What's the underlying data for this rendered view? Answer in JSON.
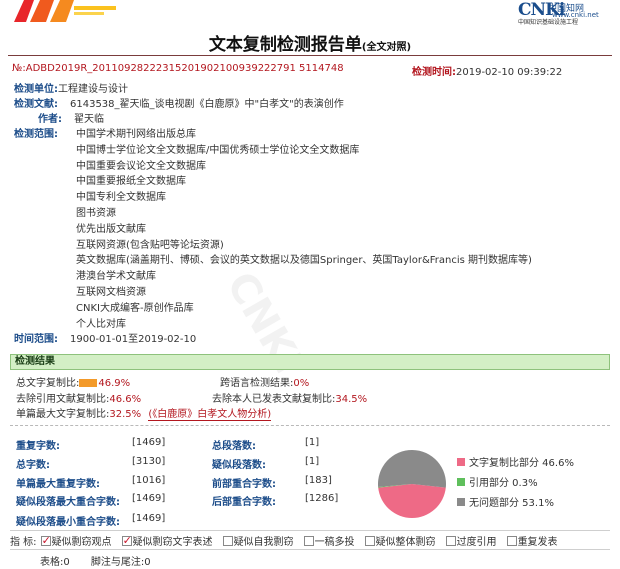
{
  "title_main": "文本复制检测报告单",
  "title_sub": "(全文对照)",
  "cnki": {
    "brand": "CNKi",
    "cn_name": "中国知网",
    "url": "www.cnki.net",
    "slogan": "中国知识基础设施工程"
  },
  "report_no": "№:ADBD2019R_20110928222315201902100939222791 5114748",
  "check_time": {
    "label": "检测时间:",
    "value": "2019-02-10 09:39:22"
  },
  "unit": {
    "label": "检测单位:",
    "value": "工程建设与设计"
  },
  "doc": {
    "label": "检测文献:",
    "value": "6143538_翟天临_谈电视剧《白鹿原》中\"白孝文\"的表演创作"
  },
  "author": {
    "label": "作者:",
    "value": "翟天临"
  },
  "scope": {
    "label": "检测范围:",
    "items": [
      "中国学术期刊网络出版总库",
      "中国博士学位论文全文数据库/中国优秀硕士学位论文全文数据库",
      "中国重要会议论文全文数据库",
      "中国重要报纸全文数据库",
      "中国专利全文数据库",
      "图书资源",
      "优先出版文献库",
      "互联网资源(包含贴吧等论坛资源)",
      "英文数据库(涵盖期刊、博硕、会议的英文数据以及德国Springer、英国Taylor&Francis 期刊数据库等)",
      "港澳台学术文献库",
      "互联网文档资源",
      "CNKI大成编客-原创作品库",
      "个人比对库"
    ]
  },
  "time_range": {
    "label": "时间范围:",
    "value": "1900-01-01至2019-02-10"
  },
  "results_header": "检测结果",
  "results": {
    "total_rate": {
      "label": "总文字复制比:",
      "value": "46.9%"
    },
    "cross_lang": {
      "label": "跨语言检测结果:",
      "value": "0%"
    },
    "excl_quote": {
      "label": "去除引用文献复制比:",
      "value": "46.6%"
    },
    "excl_self": {
      "label": "去除本人已发表文献复制比:",
      "value": "34.5%"
    },
    "max_single": {
      "label": "单篇最大文字复制比:",
      "value": "32.5%",
      "doc": "(《白鹿原》白孝文人物分析)"
    }
  },
  "stats": {
    "dup_chars": {
      "label": "重复字数:",
      "value": "[1469]"
    },
    "total_paras": {
      "label": "总段落数:",
      "value": "[1]"
    },
    "total_chars": {
      "label": "总字数:",
      "value": "[3130]"
    },
    "sus_paras": {
      "label": "疑似段落数:",
      "value": "[1]"
    },
    "max_para_dup": {
      "label": "单篇最大重复字数:",
      "value": "[1016]"
    },
    "front_overlap": {
      "label": "前部重合字数:",
      "value": "[183]"
    },
    "sus_max_overlap": {
      "label": "疑似段落最大重合字数:",
      "value": "[1469]"
    },
    "back_overlap": {
      "label": "后部重合字数:",
      "value": "[1286]"
    },
    "sus_min_overlap": {
      "label": "疑似段落最小重合字数:",
      "value": "[1469]"
    }
  },
  "pie": {
    "slices": [
      {
        "label": "文字复制比部分",
        "value": 46.6,
        "color": "#ee6a86"
      },
      {
        "label": "引用部分",
        "value": 0.3,
        "color": "#5fbf5c"
      },
      {
        "label": "无问题部分",
        "value": 53.1,
        "color": "#8a8a8a"
      }
    ],
    "texts": [
      "文字复制比部分 46.6%",
      "引用部分 0.3%",
      "无问题部分 53.1%"
    ]
  },
  "indicators": {
    "label": "指  标:",
    "items": [
      {
        "label": "疑似剽窃观点",
        "checked": true
      },
      {
        "label": "疑似剽窃文字表述",
        "checked": true
      },
      {
        "label": "疑似自我剽窃",
        "checked": false
      },
      {
        "label": "一稿多投",
        "checked": false
      },
      {
        "label": "疑似整体剽窃",
        "checked": false
      },
      {
        "label": "过度引用",
        "checked": false
      },
      {
        "label": "重复发表",
        "checked": false
      }
    ]
  },
  "footer": {
    "tables": "表格:0",
    "notes": "脚注与尾注:0"
  },
  "watermark": "CNKI"
}
